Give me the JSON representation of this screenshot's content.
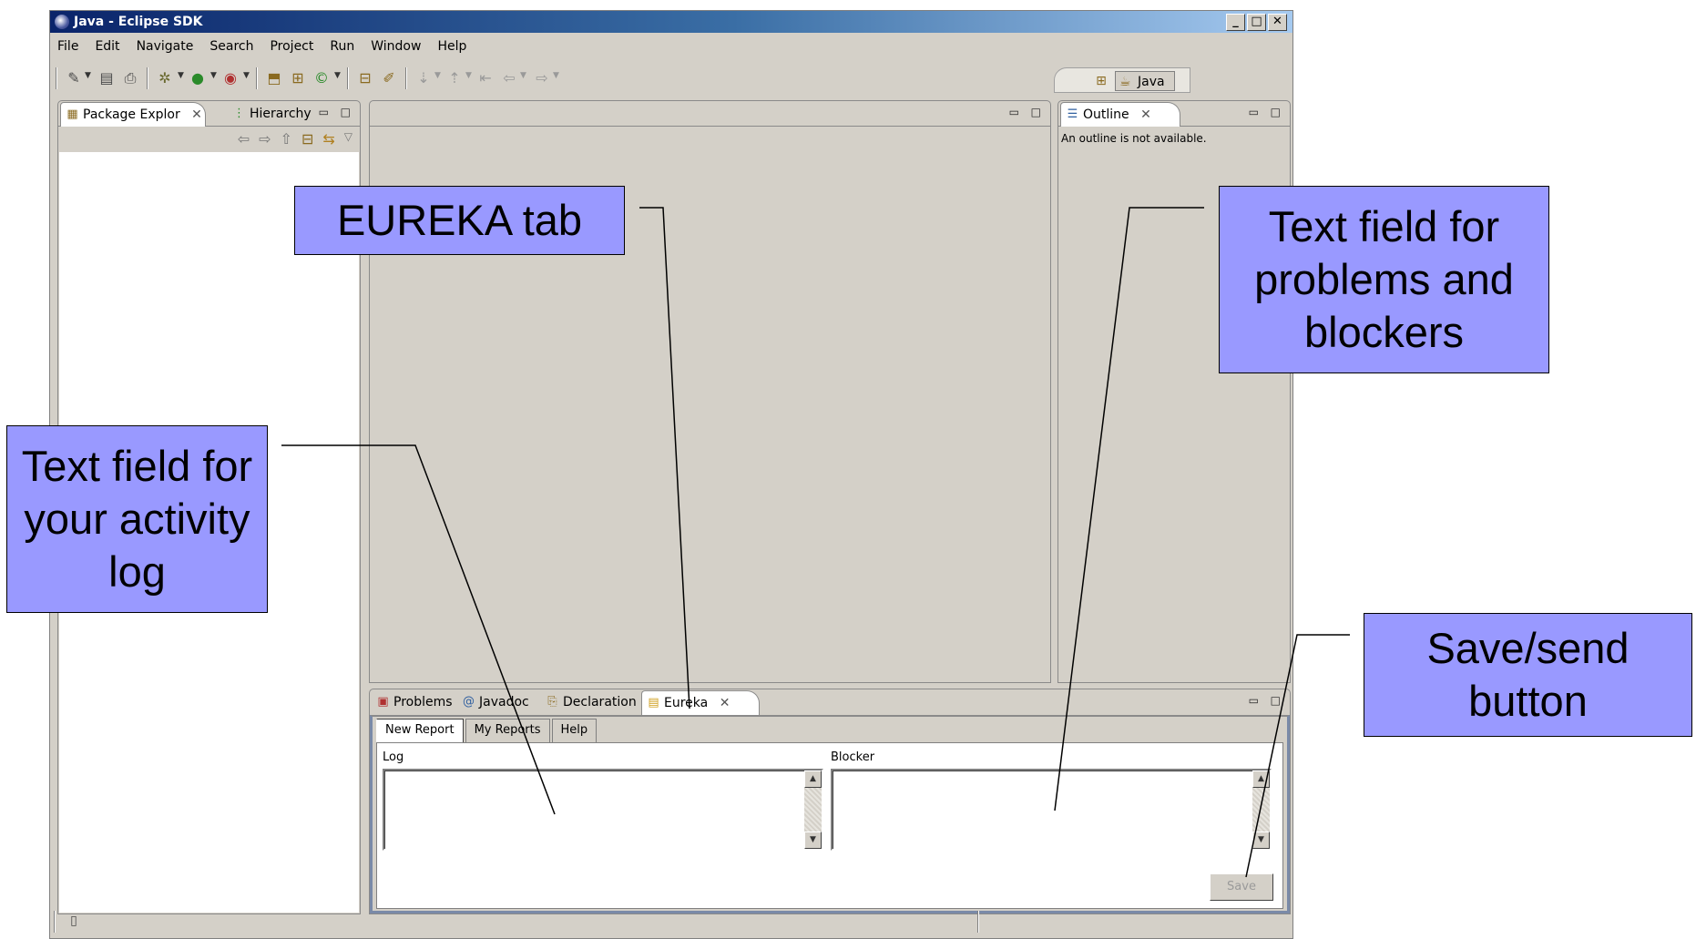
{
  "window": {
    "title": "Java - Eclipse SDK",
    "controls": [
      "_",
      "□",
      "✕"
    ]
  },
  "menu": [
    "File",
    "Edit",
    "Navigate",
    "Search",
    "Project",
    "Run",
    "Window",
    "Help"
  ],
  "perspective": {
    "label": "Java"
  },
  "left_view": {
    "tabs": [
      "Package Explor",
      "Hierarchy"
    ]
  },
  "outline_view": {
    "tab": "Outline",
    "message": "An outline is not available."
  },
  "bottom_view": {
    "tabs": [
      "Problems",
      "Javadoc",
      "Declaration",
      "Eureka"
    ],
    "subtabs": [
      "New Report",
      "My Reports",
      "Help"
    ],
    "log_label": "Log",
    "blocker_label": "Blocker",
    "save_label": "Save"
  },
  "callouts": {
    "eureka_tab": "EUREKA tab",
    "problems_field": "Text field for problems and blockers",
    "activity_log": "Text field for your activity log",
    "save_button": "Save/send button"
  },
  "icons": {
    "close": "close-icon",
    "minimize": "minimize-icon",
    "maximize": "maximize-icon"
  }
}
